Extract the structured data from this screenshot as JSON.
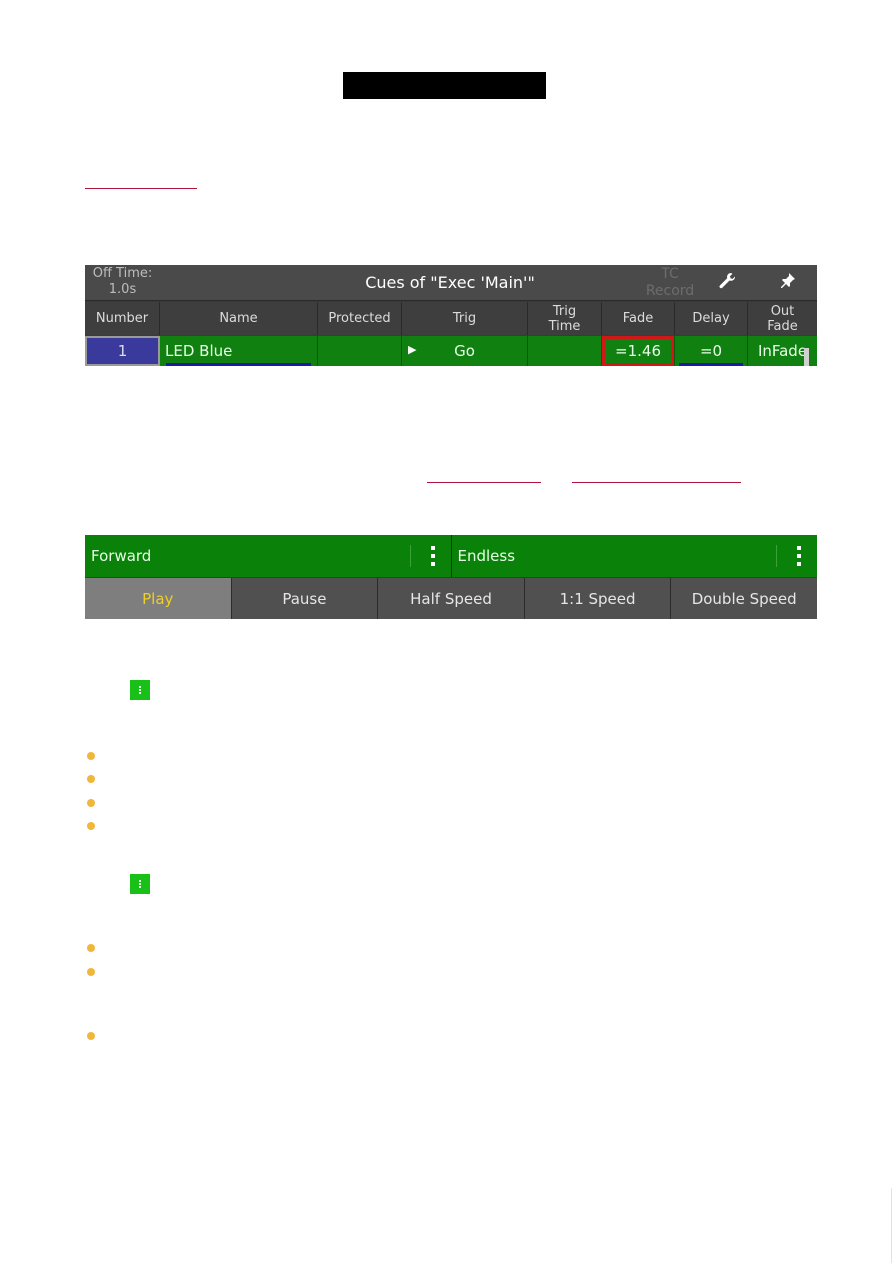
{
  "cue_sheet": {
    "off_time_label": "Off Time:",
    "off_time_value": "1.0s",
    "title": "Cues of \"Exec 'Main'\"",
    "tc_label": "TC",
    "record_label": "Record",
    "wrench_icon": "🔧",
    "pin_icon": "📌",
    "columns": [
      "Number",
      "Name",
      "Protected",
      "Trig",
      "Trig Time",
      "Fade",
      "Delay",
      "Out Fade"
    ],
    "columns_multiline": {
      "trig_time": [
        "Trig",
        "Time"
      ],
      "out_fade": [
        "Out",
        "Fade"
      ]
    },
    "row": {
      "number": "1",
      "name": "LED Blue",
      "protected": "",
      "trig_arrow": "▶",
      "trig": "Go",
      "trig_time": "",
      "fade": "=1.46",
      "delay": "=0",
      "out_fade": "InFade"
    },
    "colors": {
      "row_green": "#108010",
      "number_blue": "#3a3a9c",
      "highlight_red": "#d01818"
    }
  },
  "playback": {
    "mode": "Forward",
    "loop": "Endless",
    "speed_buttons": [
      "Play",
      "Pause",
      "Half Speed",
      "1:1 Speed",
      "Double Speed"
    ],
    "active_button": "Play",
    "colors": {
      "active_text": "#f0d020",
      "mode_green": "#0a820a"
    }
  }
}
